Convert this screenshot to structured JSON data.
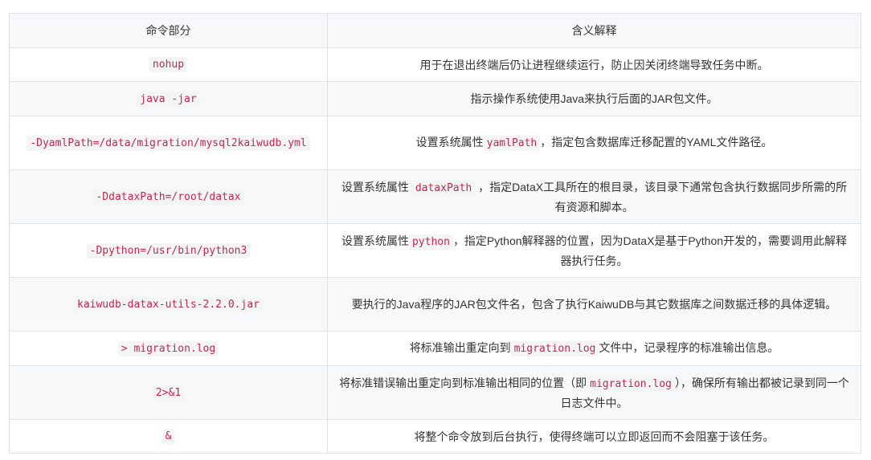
{
  "headers": {
    "command": "命令部分",
    "meaning": "含义解释"
  },
  "rows": [
    {
      "cmd": "nohup",
      "desc": [
        {
          "t": "用于在退出终端后仍让进程继续运行，防止因关闭终端导致任务中断。"
        }
      ]
    },
    {
      "cmd": "java -jar",
      "desc": [
        {
          "t": "指示操作系统使用Java来执行后面的JAR包文件。"
        }
      ]
    },
    {
      "cmd": "-DyamlPath=/data/migration/mysql2kaiwudb.yml",
      "desc": [
        {
          "t": "设置系统属性"
        },
        {
          "c": "yamlPath"
        },
        {
          "t": "，指定包含数据库迁移配置的YAML文件路径。"
        }
      ]
    },
    {
      "cmd": "-DdataxPath=/root/datax",
      "desc": [
        {
          "t": "设置系统属性 "
        },
        {
          "c": "dataxPath"
        },
        {
          "t": " ，指定DataX工具所在的根目录，该目录下通常包含执行数据同步所需的所有资源和脚本。"
        }
      ]
    },
    {
      "cmd": "-Dpython=/usr/bin/python3",
      "desc": [
        {
          "t": "设置系统属性"
        },
        {
          "c": "python"
        },
        {
          "t": "，指定Python解释器的位置，因为DataX是基于Python开发的，需要调用此解释器执行任务。"
        }
      ]
    },
    {
      "cmd": "kaiwudb-datax-utils-2.2.0.jar",
      "desc": [
        {
          "t": "要执行的Java程序的JAR包文件名，包含了执行KaiwuDB与其它数据库之间数据迁移的具体逻辑。"
        }
      ]
    },
    {
      "cmd": "> migration.log",
      "desc": [
        {
          "t": "将标准输出重定向到"
        },
        {
          "c": "migration.log"
        },
        {
          "t": "文件中，记录程序的标准输出信息。"
        }
      ]
    },
    {
      "cmd": "2>&1",
      "desc": [
        {
          "t": "将标准错误输出重定向到标准输出相同的位置（即"
        },
        {
          "c": "migration.log"
        },
        {
          "t": "），确保所有输出都被记录到同一个日志文件中。"
        }
      ]
    },
    {
      "cmd": "&",
      "desc": [
        {
          "t": "将整个命令放到后台执行，使得终端可以立即返回而不会阻塞于该任务。"
        }
      ]
    }
  ]
}
